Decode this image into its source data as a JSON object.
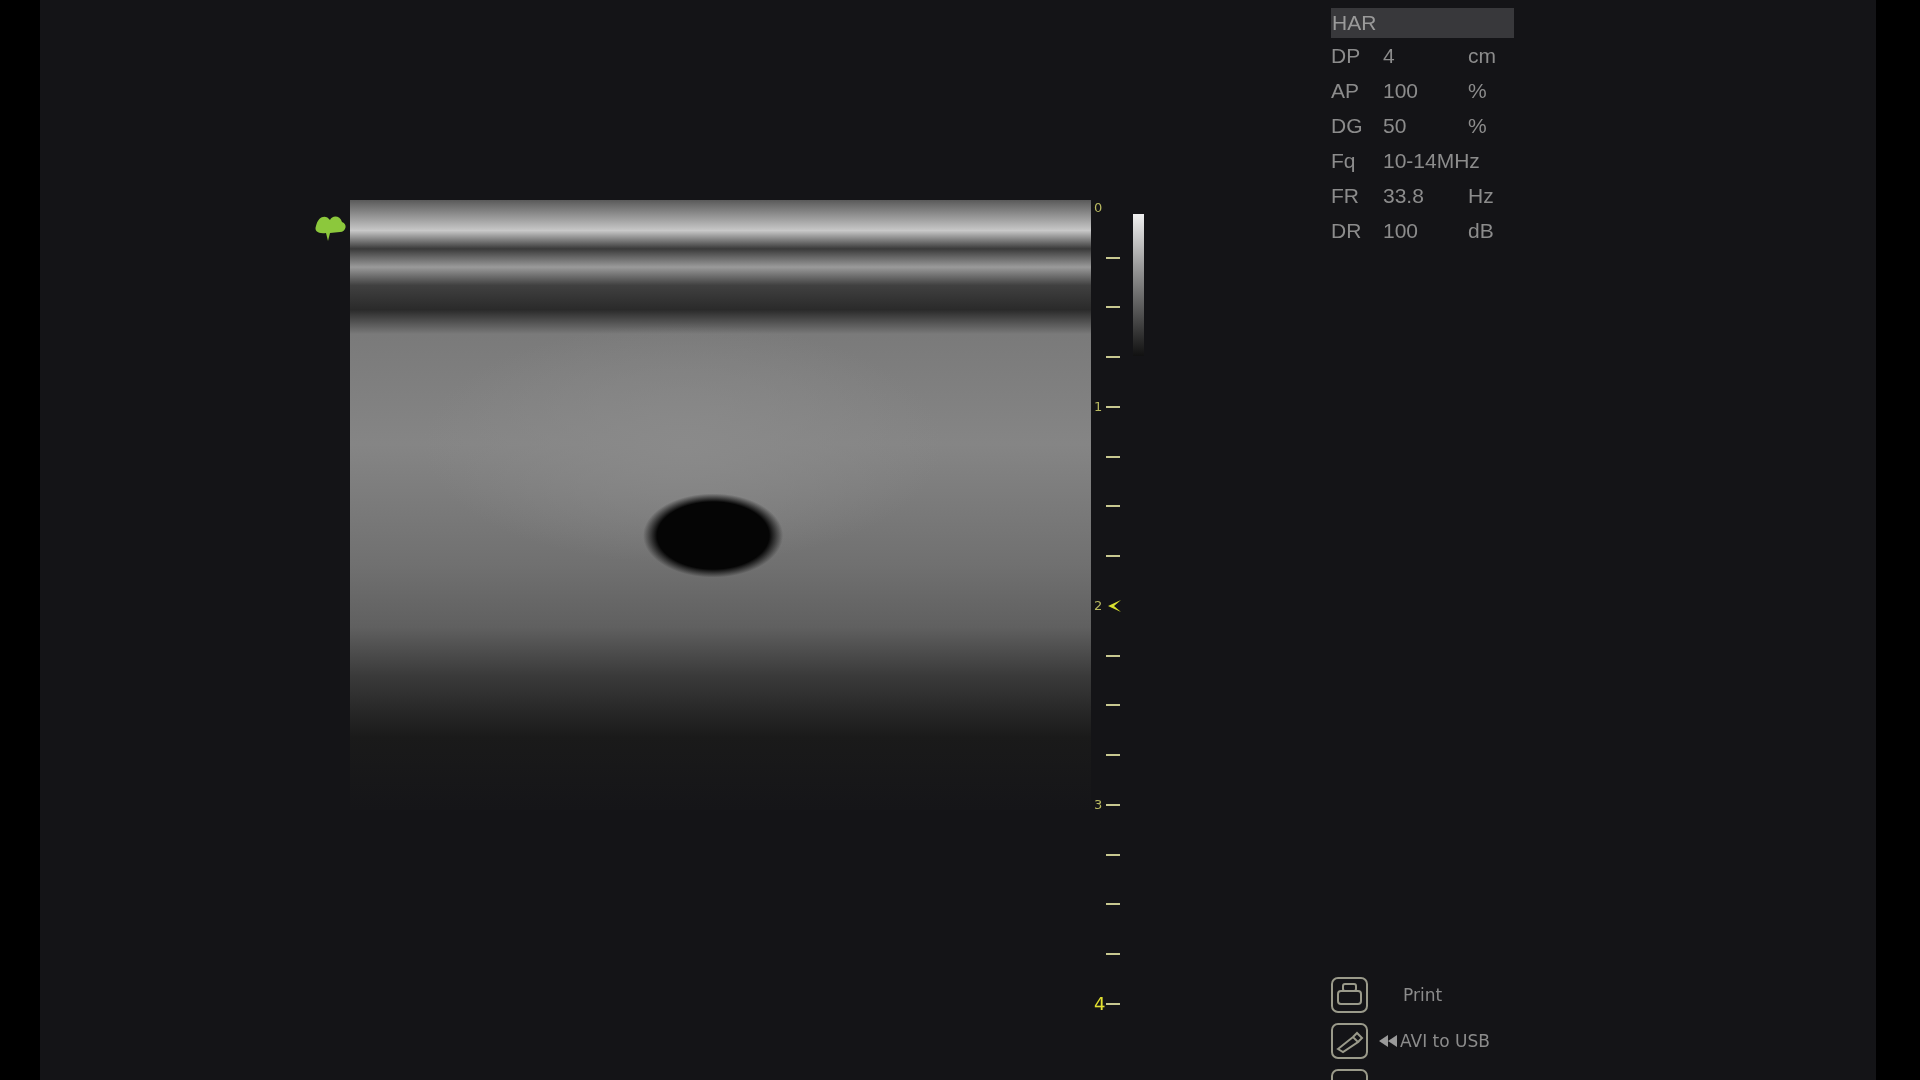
{
  "mode": {
    "label": "HAR",
    "selected": true
  },
  "parameters": [
    {
      "name": "DP",
      "value": "4",
      "unit": "cm"
    },
    {
      "name": "AP",
      "value": "100",
      "unit": "%"
    },
    {
      "name": "DG",
      "value": "50",
      "unit": "%"
    },
    {
      "name": "Fq",
      "value": "10-14MHz"
    },
    {
      "name": "FR",
      "value": "33.8",
      "unit": "Hz"
    },
    {
      "name": "DR",
      "value": "100",
      "unit": "dB"
    }
  ],
  "depth_scale": [
    {
      "label": "0",
      "focus": false
    },
    {
      "label": "1",
      "focus": false
    },
    {
      "label": "2",
      "focus": true
    },
    {
      "label": "3",
      "focus": false
    },
    {
      "label": "4",
      "focus": false
    }
  ],
  "actions": [
    {
      "kind": "print",
      "label": "Print"
    },
    {
      "kind": "usb",
      "label": "AVI to USB"
    },
    {
      "kind": "partial"
    }
  ]
}
